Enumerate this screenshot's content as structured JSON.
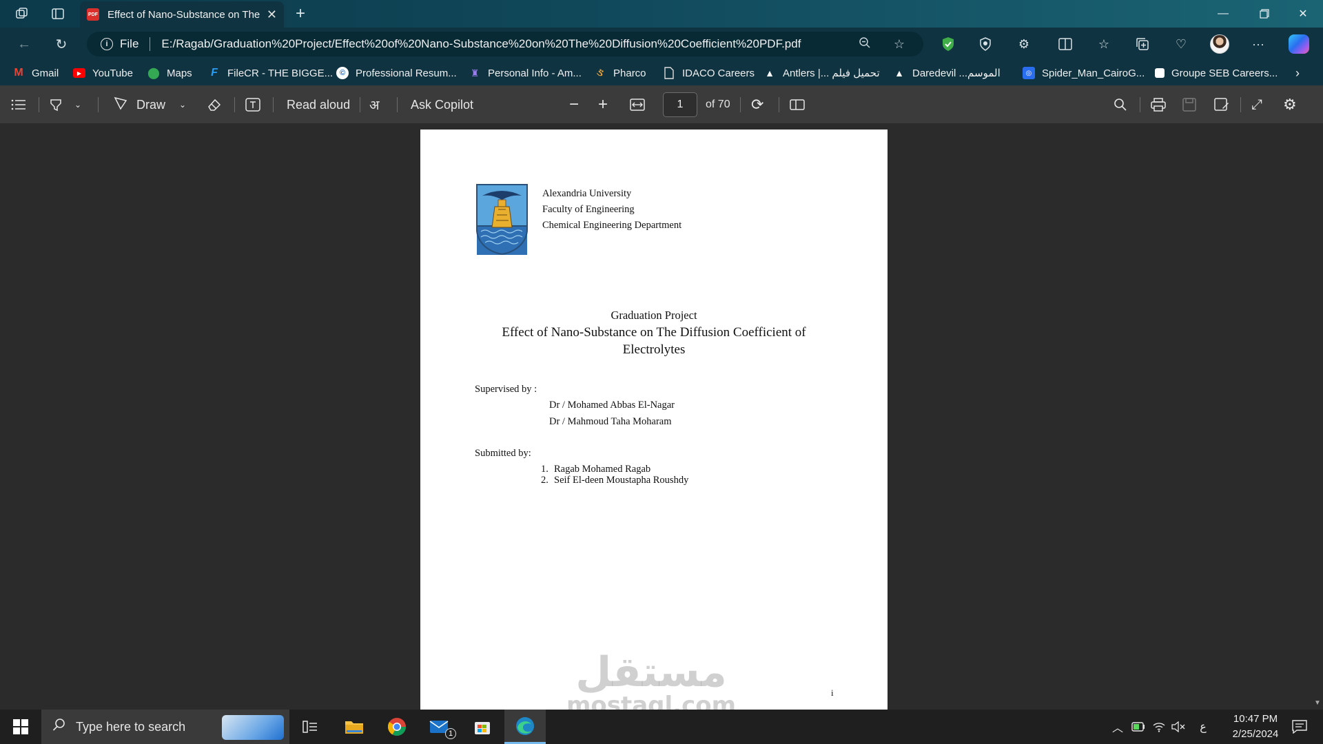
{
  "browser": {
    "tab_title": "Effect of Nano-Substance on The Diffusion Coefficient of Electrolytes",
    "new_tab_symbol": "+",
    "address": {
      "scheme": "File",
      "url": "E:/Ragab/Graduation%20Project/Effect%20of%20Nano-Substance%20on%20The%20Diffusion%20Coefficient%20PDF.pdf"
    },
    "bookmarks": [
      {
        "label": "Gmail",
        "icon": "gmail-icon",
        "color": "#ea4335"
      },
      {
        "label": "YouTube",
        "icon": "youtube-icon",
        "color": "#ff0000"
      },
      {
        "label": "Maps",
        "icon": "maps-icon",
        "color": "#34a853"
      },
      {
        "label": "FileCR - THE BIGGE...",
        "icon": "filecr-icon",
        "color": "#2a9df4"
      },
      {
        "label": "Professional Resum...",
        "icon": "resume-icon",
        "color": "#ffffff"
      },
      {
        "label": "Personal Info - Am...",
        "icon": "personal-info-icon",
        "color": "#7a4cf0"
      },
      {
        "label": "Pharco",
        "icon": "pharco-icon",
        "color": "#e8a23a"
      },
      {
        "label": "IDACO Careers",
        "icon": "document-icon",
        "color": "#cccccc"
      },
      {
        "label": "Antlers |... تحميل فيلم",
        "icon": "antlers-icon",
        "color": "#ffffff"
      },
      {
        "label": "Daredevil ...الموسم",
        "icon": "daredevil-icon",
        "color": "#ffffff"
      },
      {
        "label": "Spider_Man_CairoG...",
        "icon": "spiderman-icon",
        "color": "#2a6ef0"
      },
      {
        "label": "Groupe SEB Careers...",
        "icon": "groupe-seb-icon",
        "color": "#ffffff"
      }
    ]
  },
  "pdf_toolbar": {
    "draw_label": "Draw",
    "read_aloud_label": "Read aloud",
    "ask_copilot_label": "Ask Copilot",
    "current_page": "1",
    "page_count_label": "of 70"
  },
  "document": {
    "university": "Alexandria University",
    "faculty": "Faculty of Engineering",
    "department": "Chemical Engineering Department",
    "project_label": "Graduation Project",
    "title_line1": "Effect of Nano-Substance on The Diffusion Coefficient of",
    "title_line2": "Electrolytes",
    "supervised_label": "Supervised by :",
    "supervisors": [
      "Dr / Mohamed Abbas El-Nagar",
      "Dr / Mahmoud Taha Moharam"
    ],
    "submitted_label": "Submitted by:",
    "students": [
      {
        "num": "1.",
        "name": "Ragab Mohamed Ragab"
      },
      {
        "num": "2.",
        "name": "Seif El-deen Moustapha Roushdy"
      }
    ],
    "page_number": "i"
  },
  "watermark": {
    "arabic": "مستقل",
    "latin": "mostaql.com"
  },
  "taskbar": {
    "search_placeholder": "Type here to search",
    "mail_badge": "1",
    "ime_indicator": "ع",
    "time": "10:47 PM",
    "date": "2/25/2024"
  },
  "colors": {
    "accent": "#0f3340",
    "viewer_bg": "#2b2b2b",
    "toolbar_bg": "#3b3b3b"
  }
}
